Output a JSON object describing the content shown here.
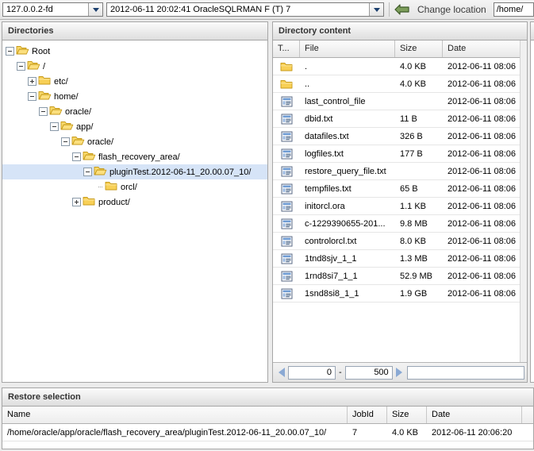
{
  "toolbar": {
    "host_value": "127.0.0.2-fd",
    "job_value": "2012-06-11 20:02:41 OracleSQLRMAN F (T) 7",
    "back_icon": "back-arrow-icon",
    "change_location_label": "Change location",
    "location_value": "/home/",
    "dropdown_icon": "chevron-down-icon"
  },
  "directories": {
    "title": "Directories",
    "items": [
      {
        "label": "Root",
        "depth": 0,
        "toggle": "minus",
        "folder": "open",
        "selected": false
      },
      {
        "label": "/",
        "depth": 1,
        "toggle": "minus",
        "folder": "open",
        "selected": false
      },
      {
        "label": "etc/",
        "depth": 2,
        "toggle": "plus",
        "folder": "closed",
        "selected": false
      },
      {
        "label": "home/",
        "depth": 2,
        "toggle": "minus",
        "folder": "open",
        "selected": false
      },
      {
        "label": "oracle/",
        "depth": 3,
        "toggle": "minus",
        "folder": "open",
        "selected": false
      },
      {
        "label": "app/",
        "depth": 4,
        "toggle": "minus",
        "folder": "open",
        "selected": false
      },
      {
        "label": "oracle/",
        "depth": 5,
        "toggle": "minus",
        "folder": "open",
        "selected": false
      },
      {
        "label": "flash_recovery_area/",
        "depth": 6,
        "toggle": "minus",
        "folder": "open",
        "selected": false
      },
      {
        "label": "pluginTest.2012-06-11_20.00.07_10/",
        "depth": 7,
        "toggle": "minus",
        "folder": "open",
        "selected": true
      },
      {
        "label": "orcl/",
        "depth": 8,
        "toggle": "none",
        "folder": "closed",
        "selected": false
      },
      {
        "label": "product/",
        "depth": 6,
        "toggle": "plus",
        "folder": "closed",
        "selected": false
      }
    ]
  },
  "content": {
    "title": "Directory content",
    "columns": [
      "T...",
      "File",
      "Size",
      "Date"
    ],
    "rows": [
      {
        "icon": "folder-icon",
        "file": ".",
        "size": "4.0 KB",
        "date": "2012-06-11 08:06"
      },
      {
        "icon": "folder-icon",
        "file": "..",
        "size": "4.0 KB",
        "date": "2012-06-11 08:06"
      },
      {
        "icon": "document-icon",
        "file": "last_control_file",
        "size": "",
        "date": "2012-06-11 08:06"
      },
      {
        "icon": "document-icon",
        "file": "dbid.txt",
        "size": "11 B",
        "date": "2012-06-11 08:06"
      },
      {
        "icon": "document-icon",
        "file": "datafiles.txt",
        "size": "326 B",
        "date": "2012-06-11 08:06"
      },
      {
        "icon": "document-icon",
        "file": "logfiles.txt",
        "size": "177 B",
        "date": "2012-06-11 08:06"
      },
      {
        "icon": "document-icon",
        "file": "restore_query_file.txt",
        "size": "",
        "date": "2012-06-11 08:06"
      },
      {
        "icon": "document-icon",
        "file": "tempfiles.txt",
        "size": "65 B",
        "date": "2012-06-11 08:06"
      },
      {
        "icon": "document-icon",
        "file": "initorcl.ora",
        "size": "1.1 KB",
        "date": "2012-06-11 08:06"
      },
      {
        "icon": "document-icon",
        "file": "c-1229390655-201...",
        "size": "9.8 MB",
        "date": "2012-06-11 08:06"
      },
      {
        "icon": "document-icon",
        "file": "controlorcl.txt",
        "size": "8.0 KB",
        "date": "2012-06-11 08:06"
      },
      {
        "icon": "document-icon",
        "file": "1tnd8sjv_1_1",
        "size": "1.3 MB",
        "date": "2012-06-11 08:06"
      },
      {
        "icon": "document-icon",
        "file": "1rnd8si7_1_1",
        "size": "52.9 MB",
        "date": "2012-06-11 08:06"
      },
      {
        "icon": "document-icon",
        "file": "1snd8si8_1_1",
        "size": "1.9 GB",
        "date": "2012-06-11 08:06"
      }
    ],
    "pager": {
      "prev_icon": "triangle-left-icon",
      "next_icon": "triangle-right-icon",
      "from": "0",
      "dash": "-",
      "to": "500",
      "filter_value": ""
    }
  },
  "restore": {
    "title": "Restore selection",
    "columns": [
      "Name",
      "JobId",
      "Size",
      "Date"
    ],
    "rows": [
      {
        "name": "/home/oracle/app/oracle/flash_recovery_area/pluginTest.2012-06-11_20.00.07_10/",
        "jobid": "7",
        "size": "4.0 KB",
        "date": "2012-06-11 20:06:20"
      }
    ]
  },
  "colors": {
    "selection": "#d6e4f7",
    "folder": "#f5c93b",
    "accent": "#8aa9d4",
    "back_arrow": "#6b8f4e"
  }
}
